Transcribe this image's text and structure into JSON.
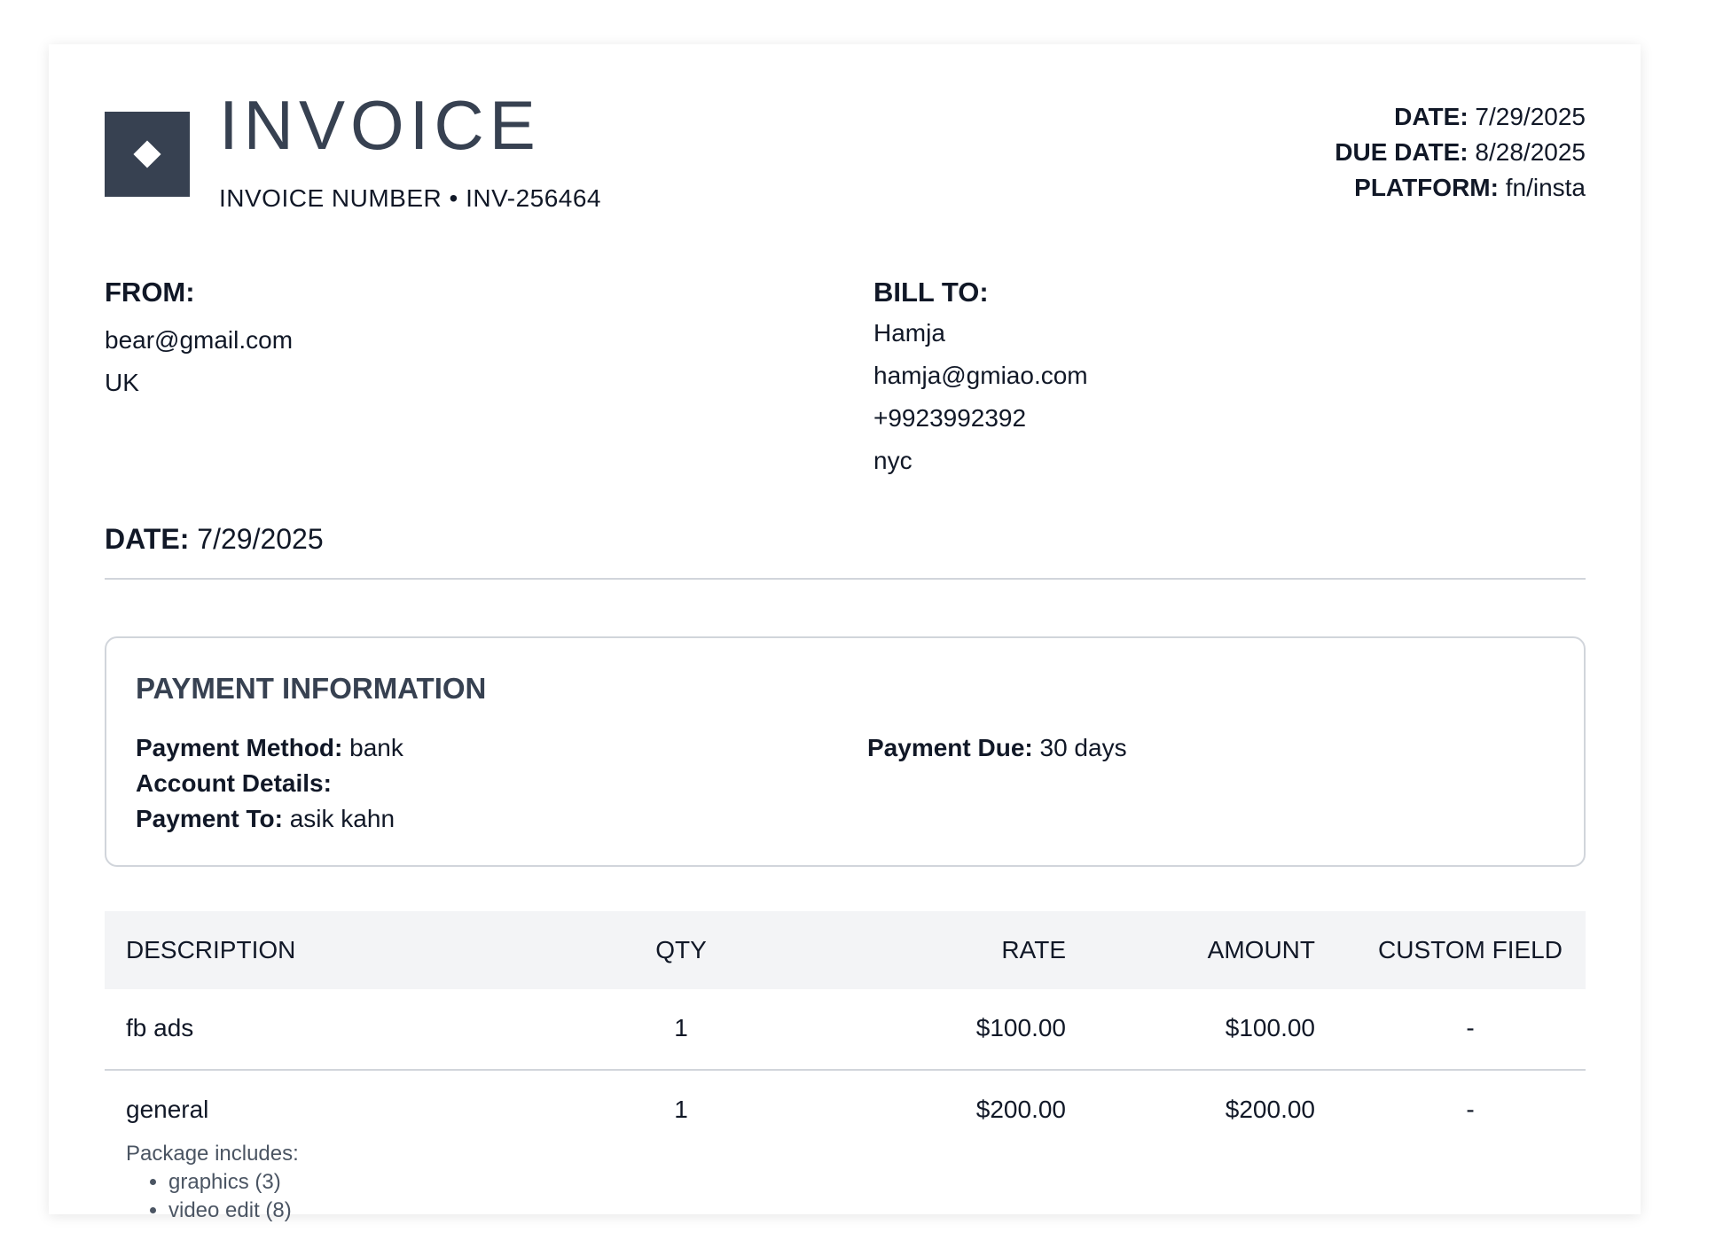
{
  "header": {
    "title": "INVOICE",
    "invoice_number": "INVOICE NUMBER • INV-256464",
    "logo_icon": "diamond-icon"
  },
  "meta": {
    "date_label": "DATE:",
    "date_value": "7/29/2025",
    "due_label": "DUE DATE:",
    "due_value": "8/28/2025",
    "platform_label": "PLATFORM:",
    "platform_value": "fn/insta"
  },
  "from": {
    "heading": "FROM:",
    "lines": [
      "bear@gmail.com",
      "UK"
    ]
  },
  "bill_to": {
    "heading": "BILL TO:",
    "lines": [
      "Hamja",
      "hamja@gmiao.com",
      "+9923992392",
      "nyc"
    ]
  },
  "date_row": {
    "label": "DATE:",
    "value": "7/29/2025"
  },
  "payment": {
    "title": "PAYMENT INFORMATION",
    "method_label": "Payment Method:",
    "method_value": "bank",
    "account_label": "Account Details:",
    "account_value": "",
    "to_label": "Payment To:",
    "to_value": "asik kahn",
    "due_label": "Payment Due:",
    "due_value": "30 days"
  },
  "table": {
    "headers": [
      "DESCRIPTION",
      "QTY",
      "RATE",
      "AMOUNT",
      "CUSTOM FIELD"
    ],
    "rows": [
      {
        "description": "fb ads",
        "qty": "1",
        "rate": "$100.00",
        "amount": "$100.00",
        "custom": "-"
      },
      {
        "description": "general",
        "qty": "1",
        "rate": "$200.00",
        "amount": "$200.00",
        "custom": "-",
        "package_label": "Package includes:",
        "package_items": [
          "graphics (3)",
          "video edit (8)"
        ]
      }
    ]
  },
  "colors": {
    "accent": "#374151",
    "header_bg": "#f3f4f6",
    "border": "#d1d5db"
  }
}
